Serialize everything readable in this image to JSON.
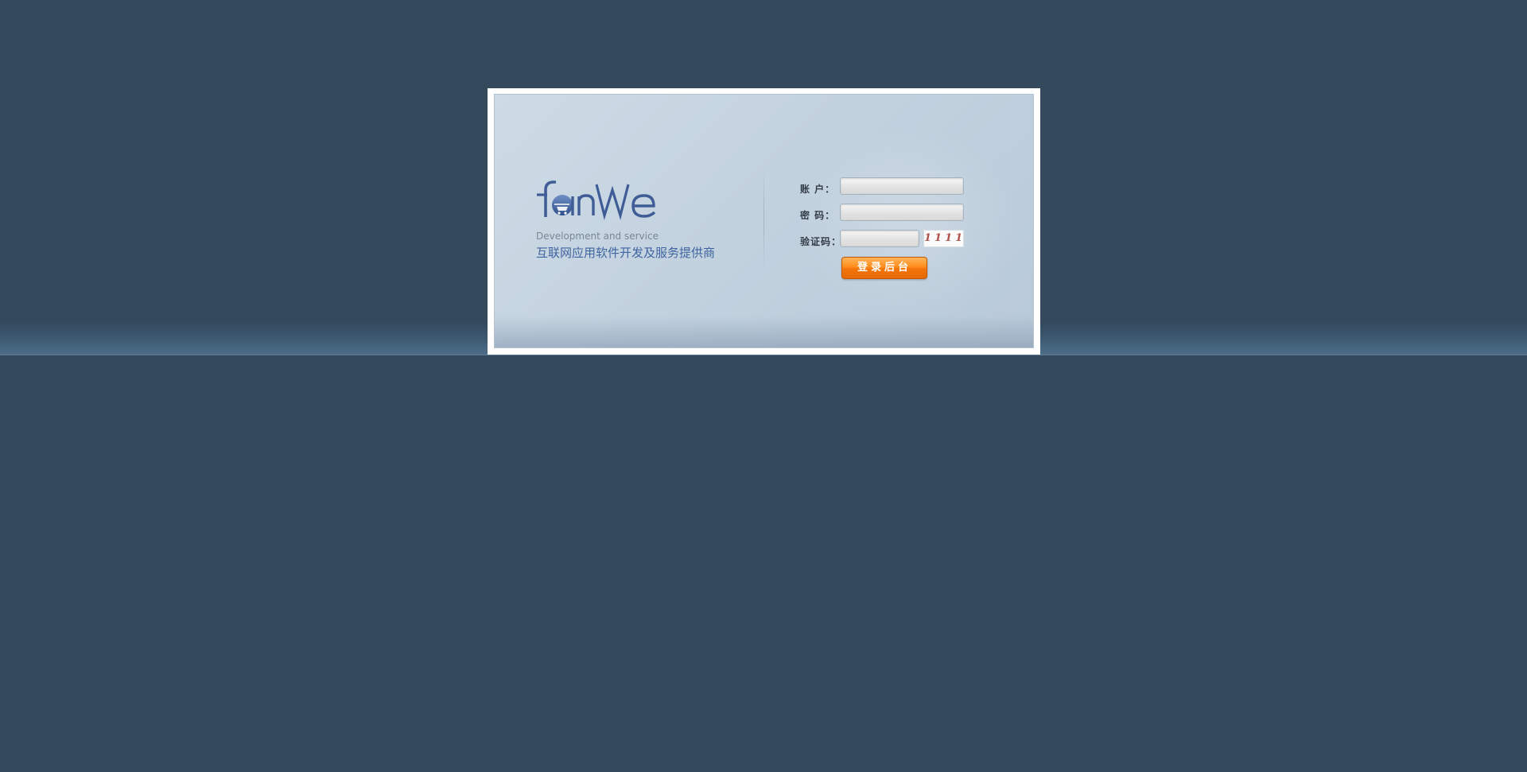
{
  "brand": {
    "logo_text": "fanWe",
    "tagline_en": "Development and service",
    "tagline_cn": "互联网应用软件开发及服务提供商",
    "logo_color": "#3f5c96"
  },
  "login": {
    "account_label": "账 户：",
    "account_value": "",
    "password_label": "密 码：",
    "password_value": "",
    "captcha_label": "验证码：",
    "captcha_value": "",
    "captcha_image_text": "1111",
    "submit_label": "登录后台"
  },
  "colors": {
    "background": "#34495c",
    "panel": "#c3d2df",
    "button": "#f2740a",
    "tagline_cn": "#3f64a0"
  }
}
